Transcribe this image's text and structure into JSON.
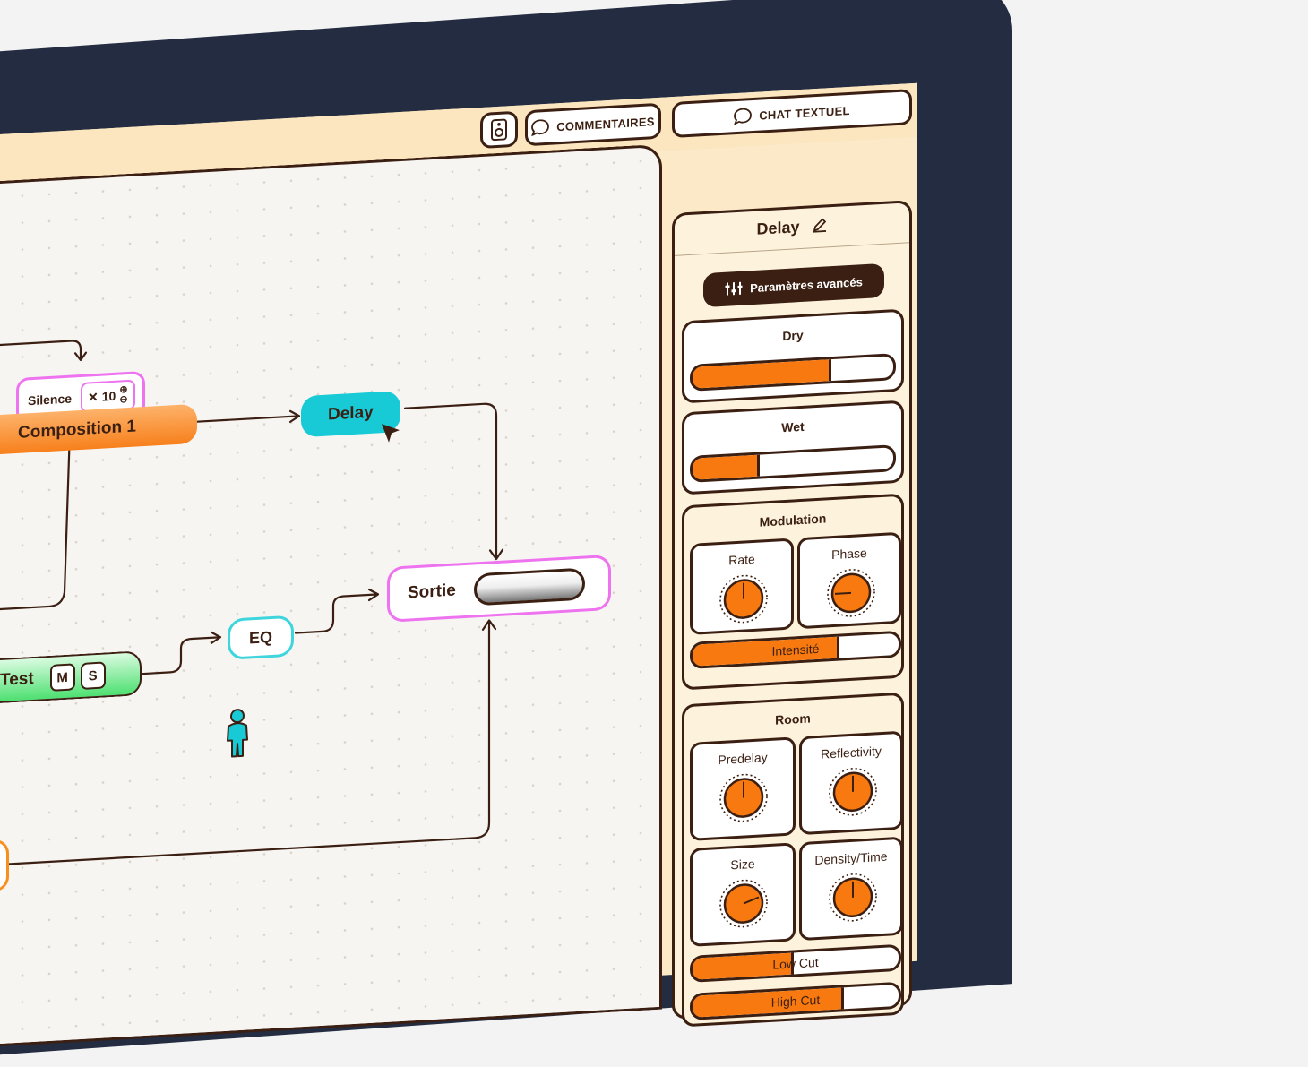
{
  "toolbar": {
    "comments_label": "COMMENTAIRES",
    "chat_label": "CHAT TEXTUEL",
    "speaker_icon": "speaker-icon",
    "comment_icon": "speech-bubble-icon"
  },
  "canvas": {
    "nodes": {
      "silence_label": "Silence",
      "silence_repeat": "10",
      "composition_label": "Composition 1",
      "delay_label": "Delay",
      "sortie_label": "Sortie",
      "eq_label": "EQ",
      "test_label": "Test",
      "mute_key": "M",
      "solo_key": "S"
    }
  },
  "panel": {
    "title": "Delay",
    "advanced_button": "Paramètres avancés",
    "dry": {
      "label": "Dry",
      "value": 0.68
    },
    "wet": {
      "label": "Wet",
      "value": 0.32
    },
    "modulation": {
      "title": "Modulation",
      "rate_label": "Rate",
      "phase_label": "Phase",
      "intensity_label": "Intensité",
      "intensity_value": 0.7
    },
    "room": {
      "title": "Room",
      "predelay_label": "Predelay",
      "reflectivity_label": "Reflectivity",
      "size_label": "Size",
      "density_label": "Density/Time",
      "lowcut_label": "Low Cut",
      "lowcut_value": 0.48,
      "highcut_label": "High Cut",
      "highcut_value": 0.72
    }
  },
  "colors": {
    "accent_orange": "#f7790f",
    "accent_cyan": "#18c9d6",
    "accent_pink": "#ee74ef",
    "accent_green": "#4ee071",
    "ink": "#3b1f12"
  }
}
